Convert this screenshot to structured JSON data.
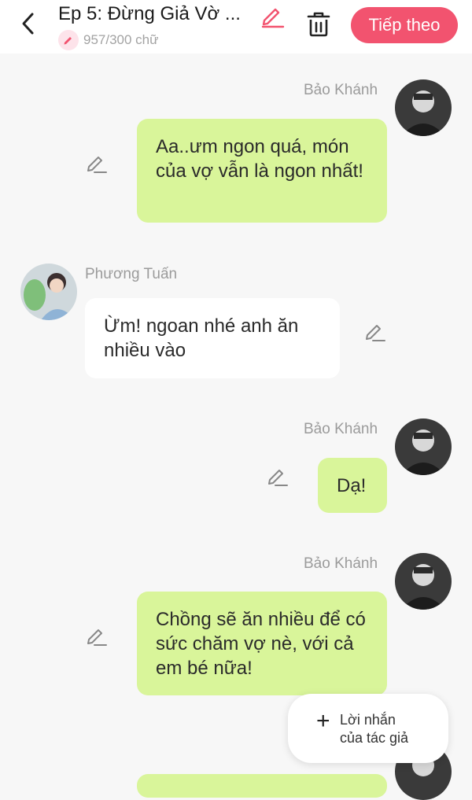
{
  "header": {
    "title": "Ep 5: Đừng Giả Vờ ...",
    "word_count": "957/300 chữ",
    "next_label": "Tiếp theo",
    "accent_color": "#f2536f"
  },
  "messages": [
    {
      "side": "right",
      "sender": "Bảo Khánh",
      "text": "Aa..ưm ngon quá, món của vợ vẫn là ngon nhất!"
    },
    {
      "side": "left",
      "sender": "Phương Tuấn",
      "text": "Ừm! ngoan nhé anh ăn nhiều vào"
    },
    {
      "side": "right",
      "sender": "Bảo Khánh",
      "text": "Dạ!"
    },
    {
      "side": "right",
      "sender": "Bảo Khánh",
      "text": "Chồng sẽ ăn nhiều để có sức chăm vợ nè, với cả em bé nữa!"
    }
  ],
  "author_note": {
    "label_line1": "Lời nhắn",
    "label_line2": "của tác giả"
  },
  "colors": {
    "right_bubble": "#d9f59a",
    "left_bubble": "#ffffff",
    "background": "#f7f7f7"
  },
  "icons": [
    "back-arrow-icon",
    "pencil-icon",
    "trash-icon",
    "plus-icon",
    "avatar"
  ]
}
